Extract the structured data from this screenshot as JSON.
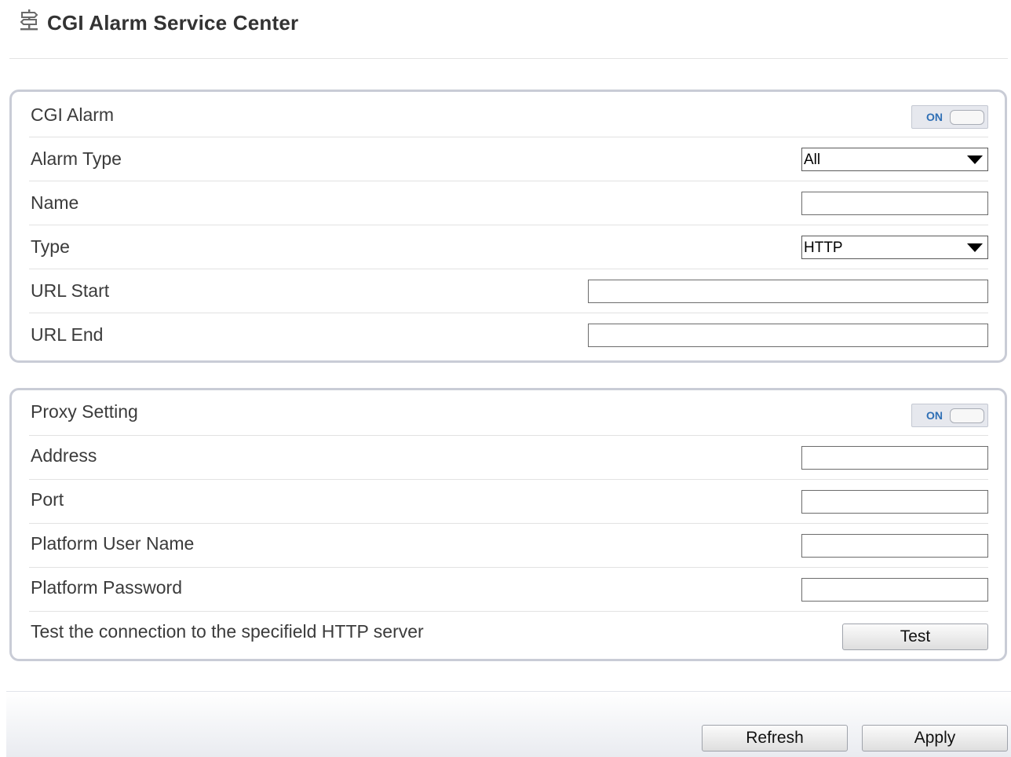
{
  "header": {
    "title": "CGI Alarm Service Center",
    "icon": "signpost-icon"
  },
  "cgi_panel": {
    "cgi_alarm": {
      "label": "CGI Alarm",
      "toggle_text": "ON"
    },
    "alarm_type": {
      "label": "Alarm Type",
      "selected": "All"
    },
    "name": {
      "label": "Name",
      "value": ""
    },
    "type": {
      "label": "Type",
      "selected": "HTTP"
    },
    "url_start": {
      "label": "URL Start",
      "value": ""
    },
    "url_end": {
      "label": "URL End",
      "value": ""
    }
  },
  "proxy_panel": {
    "proxy_setting": {
      "label": "Proxy Setting",
      "toggle_text": "ON"
    },
    "address": {
      "label": "Address",
      "value": ""
    },
    "port": {
      "label": "Port",
      "value": ""
    },
    "platform_user_name": {
      "label": "Platform User Name",
      "value": ""
    },
    "platform_password": {
      "label": "Platform Password",
      "value": ""
    },
    "test_connection": {
      "label": "Test the connection to the specifield HTTP server",
      "button_label": "Test"
    }
  },
  "footer": {
    "refresh_label": "Refresh",
    "apply_label": "Apply"
  },
  "colors": {
    "accent_text": "#2f6fb5",
    "panel_border": "#c9ccd6"
  }
}
